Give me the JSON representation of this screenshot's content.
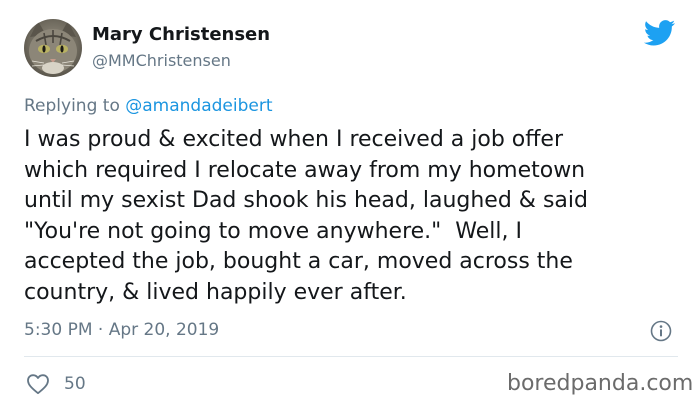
{
  "author": {
    "display_name": "Mary Christensen",
    "username": "@MMChristensen",
    "avatar_icon": "cat-avatar"
  },
  "reply": {
    "prefix": "Replying to",
    "handle": "@amandadeibert"
  },
  "tweet": {
    "lines": [
      "I was proud & excited when I received a job offer",
      "which required I relocate away from my hometown",
      "until my sexist Dad shook his head, laughed & said",
      "\"You're not going to move anywhere.\"  Well, I",
      "accepted the job, bought a car, moved across the",
      "country, & lived happily ever after."
    ]
  },
  "meta": {
    "time": "5:30 PM",
    "separator": "·",
    "date": "Apr 20, 2019"
  },
  "engagement": {
    "likes": "50"
  },
  "watermark": "boredpanda.com",
  "colors": {
    "twitter_blue": "#1da1f2",
    "link_blue": "#1b95e0",
    "muted_gray": "#657786",
    "text": "#14171a"
  },
  "icons": {
    "platform": "twitter-bird-icon",
    "info": "info-icon",
    "like": "heart-icon"
  }
}
